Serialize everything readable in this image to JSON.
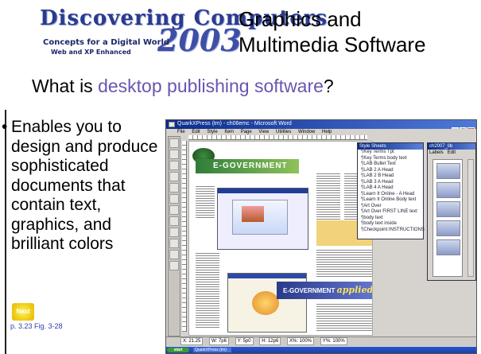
{
  "header": {
    "logo": {
      "brand": "Discovering Computers",
      "year": "2003",
      "tagline": "Concepts for a Digital World",
      "subtagline": "Web and XP Enhanced"
    },
    "title_line1": "Graphics and",
    "title_line2": "Multimedia Software"
  },
  "question": {
    "prefix": "What is ",
    "highlight": "desktop publishing software",
    "suffix": "?",
    "highlight_color": "#6a55b0"
  },
  "bullet": {
    "marker": "•",
    "text": "Enables you to design and produce sophisticated documents that contain text, graphics, and brilliant colors"
  },
  "nav": {
    "next_label": "Next",
    "reference": "p. 3.23 Fig. 3-28"
  },
  "screenshot": {
    "window_title": "QuarkXPress (tm) - ch06emc - Microsoft Word",
    "menu": [
      "File",
      "Edit",
      "Style",
      "Item",
      "Page",
      "View",
      "Utilities",
      "Window",
      "Help"
    ],
    "stylesheets_title": "Style Sheets",
    "stylesheets": [
      "Key Terms Tpt",
      "Key Terms body text",
      "LAB Bullet Text",
      "LAB 2 A Head",
      "LAB 2 B Head",
      "LAB 3 A Head",
      "LAB 4 A Head",
      "Learn It Online - A Head",
      "Learn It Online Body text",
      "Art Over",
      "Art Over FIRST LINE text",
      "body text",
      "body text inside",
      "Checkpoint INSTRUCTIONS"
    ],
    "library_title": "ch2007_lib",
    "library_tabs": [
      "Labels",
      "Edit"
    ],
    "banner_egov": "E-GOVERNMENT",
    "banner_applied": "E-GOVERNMENT",
    "banner_applied_word": "applied",
    "measurements": [
      "X: 21.25",
      "W: 7p6",
      "Y: 5p0",
      "H: 12p6",
      "X%: 100%",
      "Y%: 100%"
    ],
    "taskbar_start": "start",
    "taskbar_item": "QuarkXPress (tm)"
  }
}
